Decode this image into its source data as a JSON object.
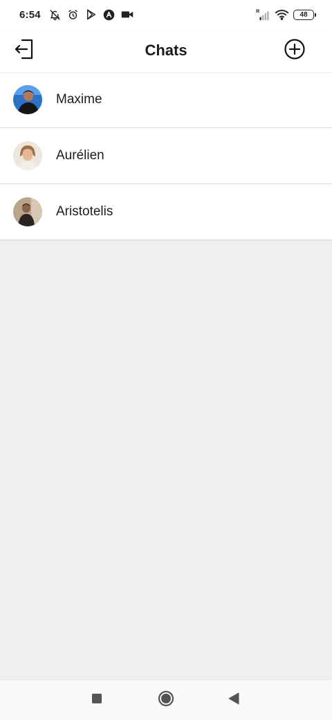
{
  "status_bar": {
    "time": "6:54",
    "battery": "48",
    "signal_label": "R",
    "icons": [
      "notifications-off-icon",
      "alarm-icon",
      "play-store-icon",
      "app-a-icon",
      "video-camera-icon",
      "signal-icon",
      "wifi-icon",
      "battery-icon"
    ]
  },
  "header": {
    "title": "Chats",
    "left_icon": "logout-icon",
    "right_icon": "add-circle-icon"
  },
  "chats": [
    {
      "name": "Maxime"
    },
    {
      "name": "Aurélien"
    },
    {
      "name": "Aristotelis"
    }
  ],
  "nav_bar": {
    "icons": [
      "recents-square-icon",
      "home-circle-icon",
      "back-triangle-icon"
    ]
  },
  "colors": {
    "background": "#efeff2",
    "surface": "#ffffff",
    "divider": "#d9d9dc",
    "text": "#1c1c1c"
  }
}
